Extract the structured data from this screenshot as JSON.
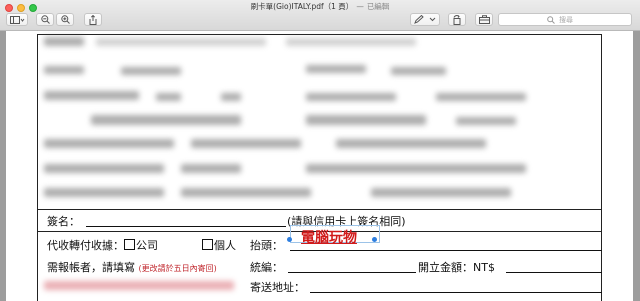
{
  "window": {
    "title": "刷卡單(Gio)ITALY.pdf（1 頁）",
    "separator": "—",
    "status": "已編輯"
  },
  "toolbar": {
    "search_placeholder": "搜尋"
  },
  "form": {
    "sign_label": "簽名：",
    "sign_note": "(請與信用卡上簽名相同)",
    "collect_label": "代收轉付收據：",
    "option_company": "公司",
    "option_personal": "個人",
    "invoice_title_label": "抬頭：",
    "invoice_title_value": "電腦玩物",
    "billing_label": "需報帳者，請填寫",
    "billing_note": "(更改請於五日內寄回)",
    "tax_id_label": "統編：",
    "amount_label": "開立金額：NT$",
    "address_label": "寄送地址："
  }
}
